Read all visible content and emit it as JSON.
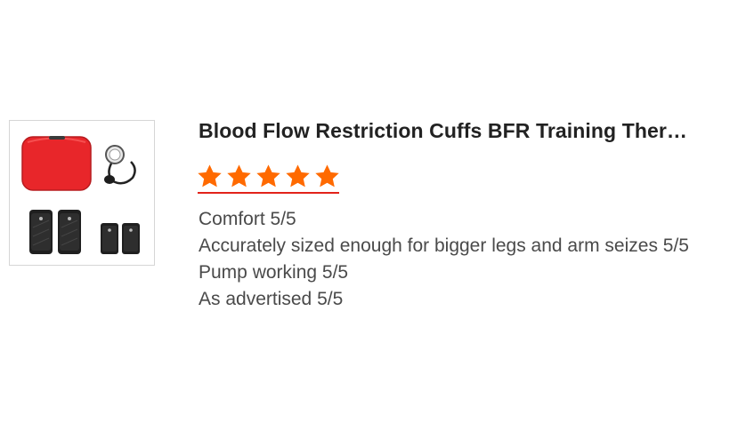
{
  "product": {
    "title": "Blood Flow Restriction Cuffs BFR Training Ther…",
    "image_icon": "bfr-cuffs-kit-image"
  },
  "rating": {
    "stars": 5,
    "max_stars": 5,
    "star_color": "#ff6a00",
    "underline_color": "#e2231a",
    "star_icon": "star-icon"
  },
  "review": {
    "lines": [
      "Comfort 5/5",
      "Accurately sized enough for bigger legs and arm seizes 5/5",
      "Pump working 5/5",
      "As advertised 5/5"
    ]
  }
}
